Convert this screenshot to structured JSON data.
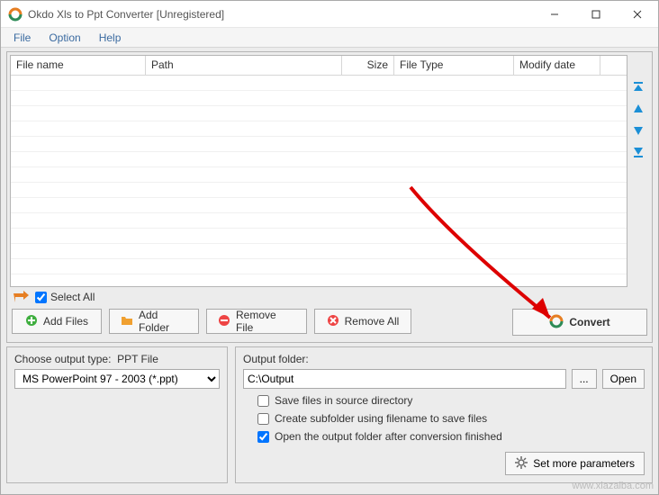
{
  "window": {
    "title": "Okdo Xls to Ppt Converter [Unregistered]"
  },
  "menu": {
    "file": "File",
    "option": "Option",
    "help": "Help"
  },
  "columns": {
    "filename": "File name",
    "path": "Path",
    "size": "Size",
    "filetype": "File Type",
    "modify": "Modify date"
  },
  "selall": {
    "label": "Select All"
  },
  "buttons": {
    "addfiles": "Add Files",
    "addfolder": "Add Folder",
    "removefile": "Remove File",
    "removeall": "Remove All",
    "convert": "Convert",
    "browse": "...",
    "open": "Open",
    "moreparams": "Set more parameters"
  },
  "output": {
    "type_label": "Choose output type:",
    "type_value": "PPT File",
    "type_option": "MS PowerPoint 97 - 2003 (*.ppt)",
    "folder_label": "Output folder:",
    "folder_value": "C:\\Output",
    "chk_source": "Save files in source directory",
    "chk_subfolder": "Create subfolder using filename to save files",
    "chk_openafter": "Open the output folder after conversion finished"
  },
  "watermark": "www.xiazaiba.com"
}
